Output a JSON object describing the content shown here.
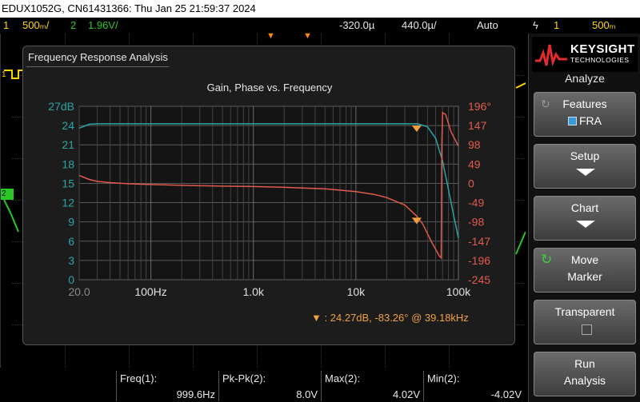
{
  "window": {
    "title": "EDUX1052G, CN61431366: Thu Jan 25 21:59:37 2024"
  },
  "status": {
    "ch1_num": "1",
    "ch1_scale": "500ₘ/",
    "ch2_num": "2",
    "ch2_scale": "1.96V/",
    "delay": "-320.0µ",
    "timebase": "440.0µ/",
    "trigger_mode": "Auto",
    "trig_icon": "ϟ",
    "trig_source": "1",
    "trig_level": "500ₘ"
  },
  "dialog": {
    "title": "Frequency Response Analysis",
    "chart_title": "Gain, Phase vs. Frequency",
    "marker_readout": "24.27dB, -83.26° @ 39.18kHz",
    "marker_prefix": ":"
  },
  "chart_data": {
    "type": "line",
    "title": "Gain, Phase vs. Frequency",
    "x_scale": "log",
    "xlim": [
      20,
      100000
    ],
    "x_tick_labels": [
      "20.0",
      "100Hz",
      "1.0k",
      "10k",
      "100k"
    ],
    "x_ticks": [
      20,
      100,
      1000,
      10000,
      100000
    ],
    "y_left": {
      "label": "",
      "unit": "dB",
      "ylim": [
        0,
        27
      ],
      "ticks": [
        0,
        3,
        6,
        9,
        12,
        15,
        18,
        21,
        24,
        27
      ],
      "tick_labels": [
        "0",
        "3",
        "6",
        "9",
        "12",
        "15",
        "18",
        "21",
        "24",
        "27dB"
      ]
    },
    "y_right": {
      "label": "",
      "unit": "°",
      "ylim": [
        -245,
        196
      ],
      "ticks": [
        -245,
        -196,
        -147,
        -98,
        -49,
        0,
        49,
        98,
        147,
        196
      ],
      "tick_labels": [
        "-245",
        "-196",
        "-147",
        "-98",
        "-49",
        "0",
        "49",
        "98",
        "147",
        "196°"
      ]
    },
    "grid": true,
    "series": [
      {
        "axis": "left",
        "color": "#2aa5a5",
        "x": [
          20,
          25,
          30,
          40,
          60,
          100,
          200,
          500,
          1000,
          2000,
          5000,
          10000,
          20000,
          30000,
          40000,
          50000,
          60000,
          70000,
          80000,
          90000,
          100000
        ],
        "values": [
          23.6,
          24.2,
          24.27,
          24.27,
          24.27,
          24.27,
          24.27,
          24.27,
          24.27,
          24.27,
          24.27,
          24.27,
          24.27,
          24.27,
          24.27,
          23.8,
          22.0,
          18.5,
          14.0,
          10.0,
          6.5
        ]
      },
      {
        "axis": "right",
        "color": "#e25a4e",
        "x": [
          20,
          25,
          30,
          40,
          60,
          100,
          200,
          500,
          1000,
          2000,
          5000,
          10000,
          15000,
          20000,
          30000,
          39180,
          45000,
          55000,
          65000,
          68000,
          69000,
          70000,
          75000,
          85000,
          100000
        ],
        "values": [
          20,
          10,
          5,
          2,
          -1,
          -3,
          -5,
          -7,
          -8,
          -10,
          -14,
          -21,
          -28,
          -36,
          -55,
          -83.26,
          -104,
          -150,
          -184,
          -190,
          100,
          180,
          175,
          130,
          95
        ]
      }
    ],
    "markers": [
      {
        "series": 0,
        "x": 39180,
        "y": 24.27
      },
      {
        "series": 1,
        "x": 39180,
        "y": -83.26
      }
    ]
  },
  "measurements": [
    {
      "label": "Freq(1):",
      "value": "999.6Hz"
    },
    {
      "label": "Pk-Pk(2):",
      "value": "8.0V"
    },
    {
      "label": "Max(2):",
      "value": "4.02V"
    },
    {
      "label": "Min(2):",
      "value": "-4.02V"
    }
  ],
  "panel": {
    "brand": "KEYSIGHT",
    "brand_sub": "TECHNOLOGIES",
    "heading": "Analyze",
    "features_label": "Features",
    "features_value": "FRA",
    "setup_label": "Setup",
    "chart_label": "Chart",
    "move_label": "Move",
    "marker_label": "Marker",
    "transparent_label": "Transparent",
    "run_label": "Run",
    "analysis_label": "Analysis"
  },
  "colors": {
    "ch1": "#ffd700",
    "ch2": "#28c828",
    "gain": "#2aa5a5",
    "phase": "#e25a4e",
    "marker": "#f0a040"
  }
}
